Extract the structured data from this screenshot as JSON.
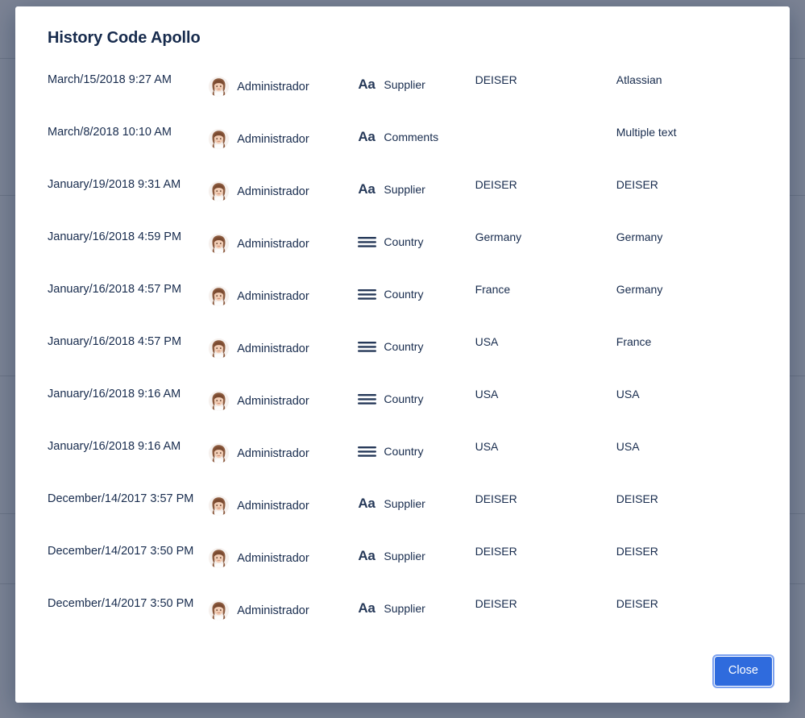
{
  "overlay": {
    "dim_color": "#7b8394"
  },
  "modal": {
    "title": "History Code Apollo",
    "footer": {
      "close_label": "Close",
      "close_color": "#2f6bdd"
    }
  },
  "history": {
    "rows": [
      {
        "date": "March/15/2018 9:27 AM",
        "user": "Administrador",
        "field_icon": "text-format-icon",
        "field": "Supplier",
        "old": "DEISER",
        "new": "Atlassian"
      },
      {
        "date": "March/8/2018 10:10 AM",
        "user": "Administrador",
        "field_icon": "text-format-icon",
        "field": "Comments",
        "old": "",
        "new": "Multiple text"
      },
      {
        "date": "January/19/2018 9:31 AM",
        "user": "Administrador",
        "field_icon": "text-format-icon",
        "field": "Supplier",
        "old": "DEISER",
        "new": "DEISER"
      },
      {
        "date": "January/16/2018 4:59 PM",
        "user": "Administrador",
        "field_icon": "list-icon",
        "field": "Country",
        "old": "Germany",
        "new": "Germany"
      },
      {
        "date": "January/16/2018 4:57 PM",
        "user": "Administrador",
        "field_icon": "list-icon",
        "field": "Country",
        "old": "France",
        "new": "Germany"
      },
      {
        "date": "January/16/2018 4:57 PM",
        "user": "Administrador",
        "field_icon": "list-icon",
        "field": "Country",
        "old": "USA",
        "new": "France"
      },
      {
        "date": "January/16/2018 9:16 AM",
        "user": "Administrador",
        "field_icon": "list-icon",
        "field": "Country",
        "old": "USA",
        "new": "USA"
      },
      {
        "date": "January/16/2018 9:16 AM",
        "user": "Administrador",
        "field_icon": "list-icon",
        "field": "Country",
        "old": "USA",
        "new": "USA"
      },
      {
        "date": "December/14/2017 3:57 PM",
        "user": "Administrador",
        "field_icon": "text-format-icon",
        "field": "Supplier",
        "old": "DEISER",
        "new": "DEISER"
      },
      {
        "date": "December/14/2017 3:50 PM",
        "user": "Administrador",
        "field_icon": "text-format-icon",
        "field": "Supplier",
        "old": "DEISER",
        "new": "DEISER"
      },
      {
        "date": "December/14/2017 3:50 PM",
        "user": "Administrador",
        "field_icon": "text-format-icon",
        "field": "Supplier",
        "old": "DEISER",
        "new": "DEISER"
      }
    ],
    "icons": {
      "text_format_glyph": "Aa",
      "avatar_icon": "user-avatar-icon"
    }
  }
}
